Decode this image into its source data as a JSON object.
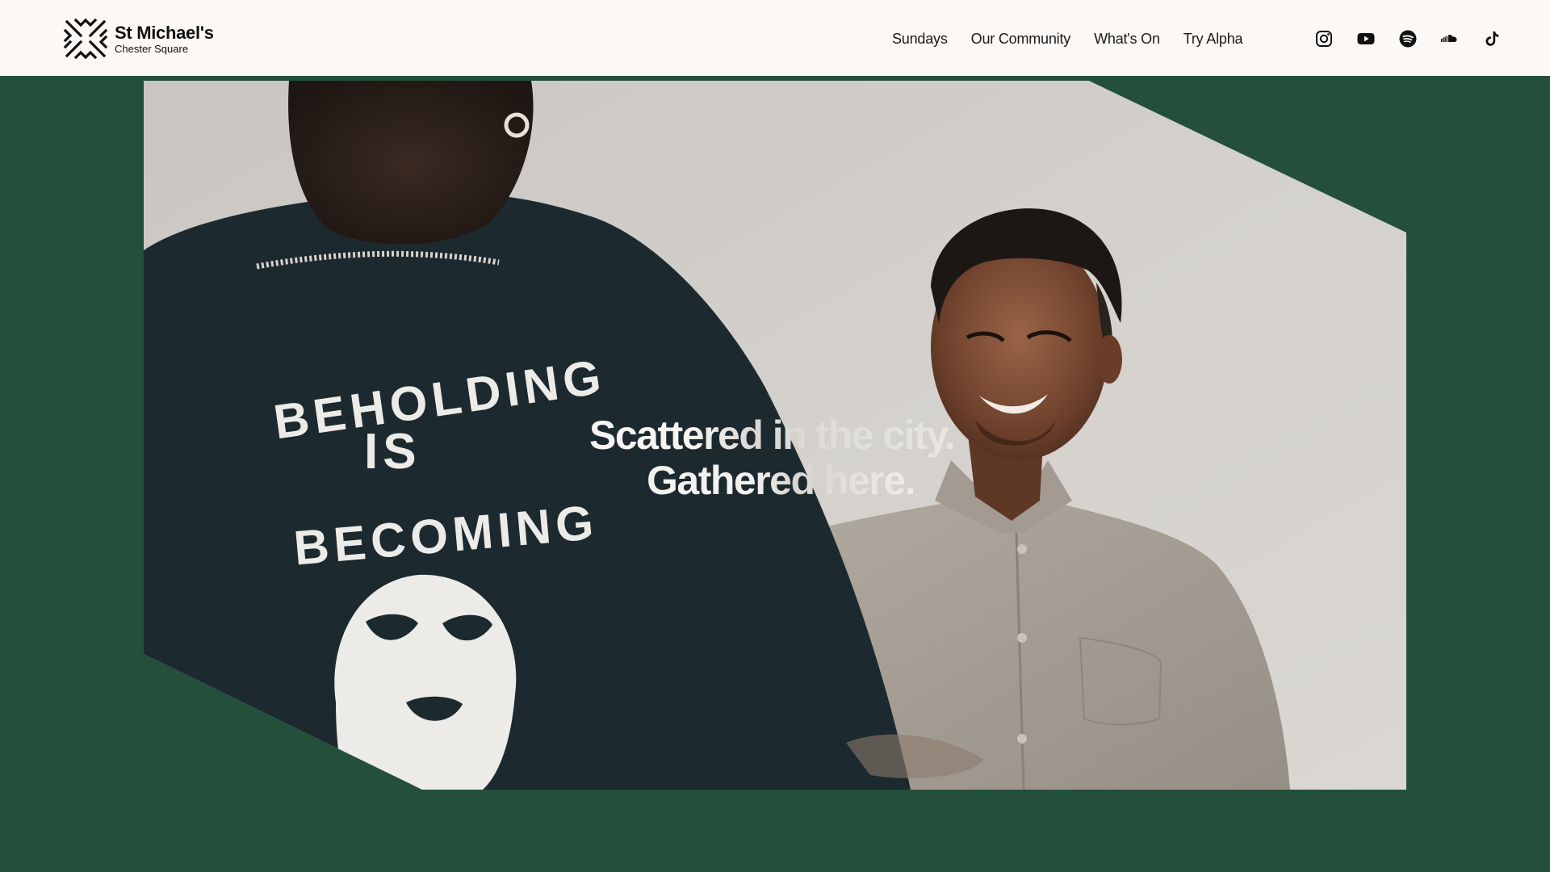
{
  "brand": {
    "name": "St Michael's",
    "subtitle": "Chester Square",
    "logo_icon": "cross-logo-icon"
  },
  "nav": {
    "items": [
      {
        "label": "Sundays"
      },
      {
        "label": "Our Community"
      },
      {
        "label": "What's On"
      },
      {
        "label": "Try Alpha"
      }
    ]
  },
  "social": [
    {
      "name": "instagram-icon"
    },
    {
      "name": "youtube-icon"
    },
    {
      "name": "spotify-icon"
    },
    {
      "name": "soundcloud-icon"
    },
    {
      "name": "tiktok-icon"
    }
  ],
  "hero": {
    "line1": "Scattered in the city.",
    "line2": "Gathered here.",
    "shirt_text_line1": "BEHOLDING",
    "shirt_text_line2": "IS",
    "shirt_text_line3": "BECOMING"
  },
  "colors": {
    "header_bg": "#fcf8f5",
    "page_bg": "#234f3b",
    "text_dark": "#111111"
  }
}
